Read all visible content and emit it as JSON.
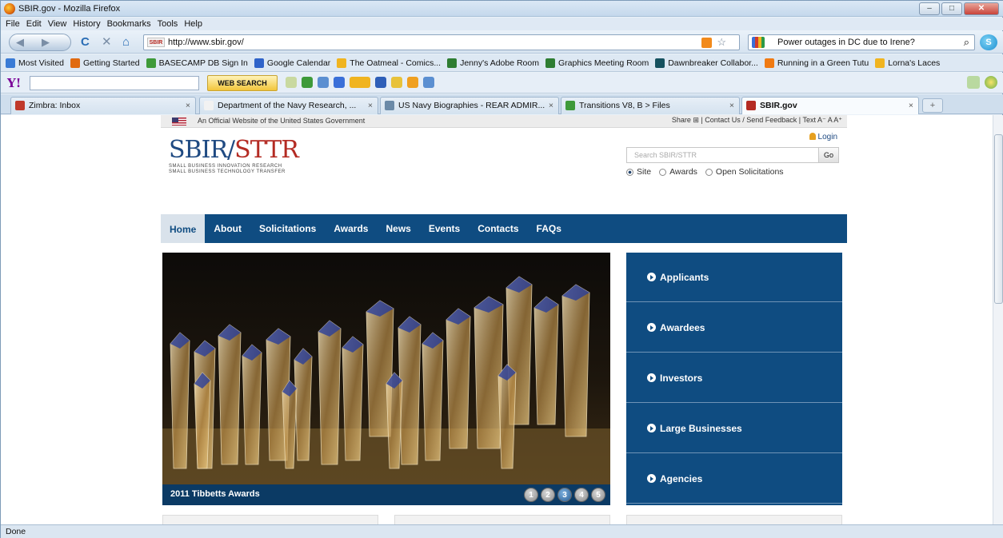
{
  "window": {
    "title": "SBIR.gov - Mozilla Firefox"
  },
  "menu": [
    "File",
    "Edit",
    "View",
    "History",
    "Bookmarks",
    "Tools",
    "Help"
  ],
  "nav": {
    "url": "http://www.sbir.gov/",
    "search_text": "Power outages in DC due to Irene?"
  },
  "bookmarks": [
    {
      "label": "Most Visited",
      "color": "#3a7bd5"
    },
    {
      "label": "Getting Started",
      "color": "#e06a10"
    },
    {
      "label": "BASECAMP DB Sign In",
      "color": "#3e9a3a"
    },
    {
      "label": "Google Calendar",
      "color": "#2f63c9"
    },
    {
      "label": "The Oatmeal - Comics...",
      "color": "#f0b420"
    },
    {
      "label": "Jenny's Adobe Room",
      "color": "#2e7d32"
    },
    {
      "label": "Graphics Meeting Room",
      "color": "#2e7d32"
    },
    {
      "label": "Dawnbreaker Collabor...",
      "color": "#15515f"
    },
    {
      "label": "Running in a Green Tutu",
      "color": "#f07a12"
    },
    {
      "label": "Lorna's Laces",
      "color": "#f0b420"
    }
  ],
  "ytoolbar": {
    "search_button": "WEB SEARCH"
  },
  "tabs": [
    {
      "label": "Zimbra: Inbox",
      "color": "#c0392b",
      "active": false
    },
    {
      "label": "Department of the Navy Research, ...",
      "color": "#f2f2f2",
      "active": false
    },
    {
      "label": "US Navy Biographies - REAR ADMIR...",
      "color": "#6b8aa8",
      "active": false
    },
    {
      "label": "Transitions V8, B > Files",
      "color": "#3e9a3a",
      "active": false
    },
    {
      "label": "SBIR.gov",
      "color": "#b42b23",
      "active": true
    }
  ],
  "status": "Done",
  "page": {
    "gov_banner": "An Official Website of the United States Government",
    "utils": "Share ⊞ |  Contact Us / Send Feedback  |  Text  A⁻  A  A⁺",
    "logo": {
      "sbir": "SBIR/",
      "sttr": "STTR",
      "sub1": "SMALL BUSINESS INNOVATION RESEARCH",
      "sub2": "SMALL BUSINESS TECHNOLOGY TRANSFER"
    },
    "login": "Login",
    "search_placeholder": "Search SBIR/STTR",
    "go": "Go",
    "radios": [
      {
        "label": "Site",
        "on": true
      },
      {
        "label": "Awards",
        "on": false
      },
      {
        "label": "Open Solicitations",
        "on": false
      }
    ],
    "mainnav": [
      "Home",
      "About",
      "Solicitations",
      "Awards",
      "News",
      "Events",
      "Contacts",
      "FAQs"
    ],
    "hero_caption": "2011 Tibbetts Awards",
    "slides": [
      "1",
      "2",
      "3",
      "4",
      "5"
    ],
    "active_slide": 3,
    "rightnav": [
      "Applicants",
      "Awardees",
      "Investors",
      "Large Businesses",
      "Agencies"
    ],
    "colors": {
      "navy": "#0f4c81",
      "red": "#b42b23"
    }
  }
}
